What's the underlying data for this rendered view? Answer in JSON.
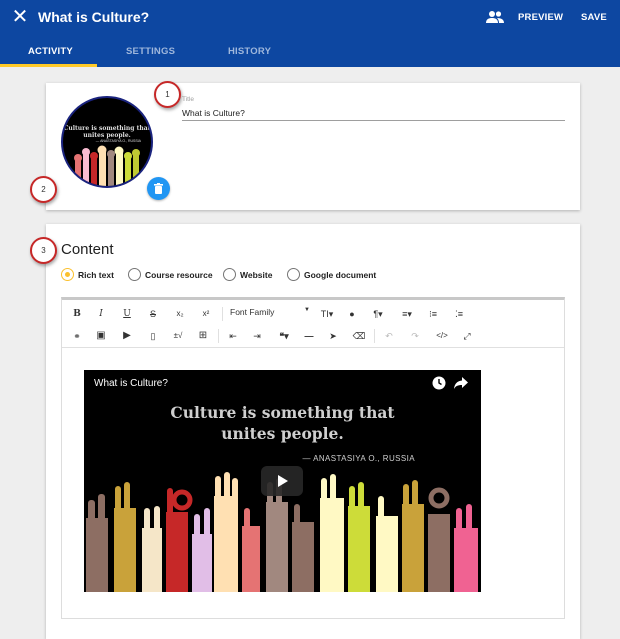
{
  "header": {
    "close_icon": "close-icon",
    "title": "What is Culture?",
    "people_icon": "people-icon",
    "preview_label": "PREVIEW",
    "save_label": "SAVE",
    "bg_color": "#0d47a1"
  },
  "tabs": [
    {
      "label": "ACTIVITY",
      "active": true
    },
    {
      "label": "SETTINGS",
      "active": false
    },
    {
      "label": "HISTORY",
      "active": false
    }
  ],
  "activity_card": {
    "thumbnail_quote": "Culture is something that unites people.",
    "thumbnail_attribution": "— ANASTASIYA O., RUSSIA",
    "delete_icon": "trash-icon",
    "title_label": "Title",
    "title_value": "What is Culture?"
  },
  "callouts": [
    "1",
    "2",
    "3"
  ],
  "content": {
    "heading": "Content",
    "radio_options": [
      {
        "label": "Rich text",
        "checked": true
      },
      {
        "label": "Course resource",
        "checked": false
      },
      {
        "label": "Website",
        "checked": false
      },
      {
        "label": "Google document",
        "checked": false
      }
    ],
    "toolbar": {
      "font_family_label": "Font Family"
    },
    "video": {
      "title": "What is Culture?",
      "quote_line1": "Culture is something that",
      "quote_line2": "unites people.",
      "attribution": "— ANASTASIYA O., RUSSIA"
    }
  },
  "accent_color": "#ffca28",
  "button_color": "#2196f3"
}
